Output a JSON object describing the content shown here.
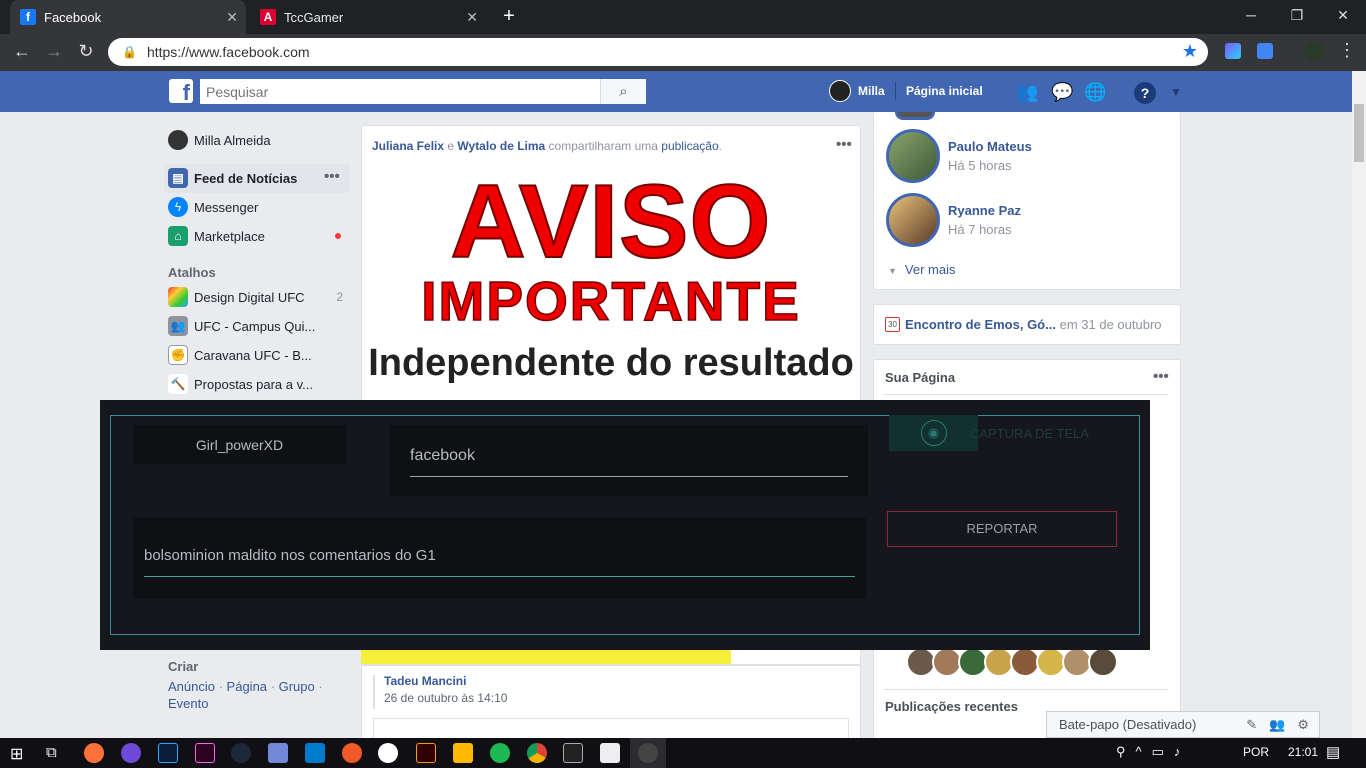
{
  "browser": {
    "tabs": [
      {
        "title": "Facebook",
        "active": true
      },
      {
        "title": "TccGamer",
        "active": false
      }
    ],
    "url": "https://www.facebook.com"
  },
  "fb": {
    "search_placeholder": "Pesquisar",
    "user_name": "Milla",
    "home_label": "Página inicial"
  },
  "left_nav": {
    "profile": "Milla Almeida",
    "items": [
      {
        "label": "Feed de Notícias"
      },
      {
        "label": "Messenger"
      },
      {
        "label": "Marketplace"
      }
    ],
    "shortcuts_title": "Atalhos",
    "shortcuts": [
      {
        "label": "Design Digital UFC",
        "count": "2"
      },
      {
        "label": "UFC - Campus Qui..."
      },
      {
        "label": "Caravana UFC - B..."
      },
      {
        "label": "Propostas para a v..."
      }
    ],
    "create_title": "Criar",
    "create_links": [
      "Anúncio",
      "Página",
      "Grupo",
      "Evento"
    ]
  },
  "post": {
    "actor1": "Juliana Felix",
    "conj": "e",
    "actor2": "Wytalo de Lima",
    "action": "compartilharam uma",
    "object": "publicação",
    "image_line1": "AVISO",
    "image_line2": "IMPORTANTE",
    "image_line3": "Independente do resultado",
    "comment_author": "Tadeu Mancini",
    "comment_time": "26 de outubro às 14:10"
  },
  "stories": [
    {
      "name": "Paulo Mateus",
      "time": "Há 5 horas"
    },
    {
      "name": "Ryanne Paz",
      "time": "Há 7 horas"
    }
  ],
  "see_more": "Ver mais",
  "event": {
    "title": "Encontro de Emos, Gó...",
    "date": "em 31 de outubro"
  },
  "your_page": {
    "title": "Sua Página"
  },
  "recent_posts": "Publicações recentes",
  "chat": "Bate-papo (Desativado)",
  "overlay": {
    "username": "Girl_powerXD",
    "site": "facebook",
    "comment": "bolsominion maldito nos comentarios do G1",
    "capture_label": "CAPTURA DE TELA",
    "report_label": "REPORTAR"
  },
  "taskbar": {
    "lang": "POR",
    "time": "21:01"
  }
}
